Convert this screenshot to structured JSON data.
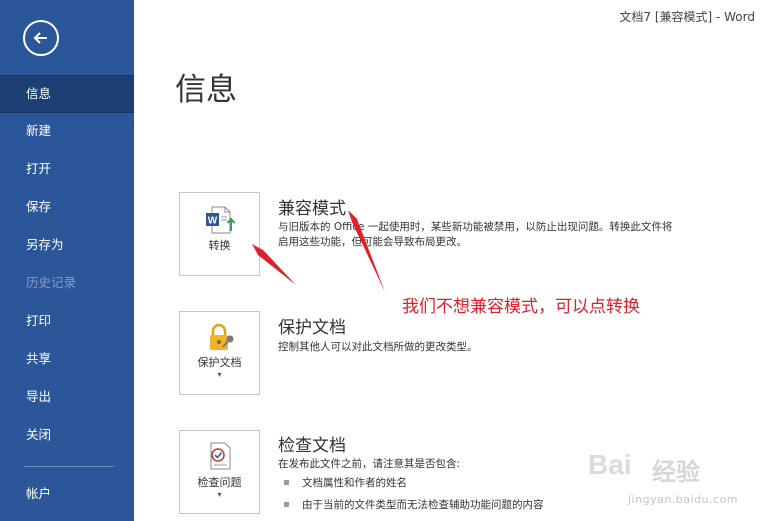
{
  "window": {
    "title": "文档7 [兼容模式]  -  Word"
  },
  "sidebar": {
    "items": [
      {
        "label": "信息"
      },
      {
        "label": "新建"
      },
      {
        "label": "打开"
      },
      {
        "label": "保存"
      },
      {
        "label": "另存为"
      },
      {
        "label": "历史记录"
      },
      {
        "label": "打印"
      },
      {
        "label": "共享"
      },
      {
        "label": "导出"
      },
      {
        "label": "关闭"
      },
      {
        "label": "帐户"
      }
    ]
  },
  "page": {
    "title": "信息"
  },
  "compat": {
    "button_label": "转换",
    "title": "兼容模式",
    "desc_line1": "与旧版本的 Office 一起使用时，某些新功能被禁用，以防止出现问题。转换此文件将",
    "desc_line2": "启用这些功能，但可能会导致布局更改。"
  },
  "protect": {
    "button_label": "保护文档",
    "caret": "▾",
    "title": "保护文档",
    "desc": "控制其他人可以对此文档所做的更改类型。"
  },
  "inspect": {
    "button_label": "检查问题",
    "caret": "▾",
    "title": "检查文档",
    "desc": "在发布此文件之前，请注意其是否包含:",
    "bullets": [
      "文档属性和作者的姓名",
      "由于当前的文件类型而无法检查辅助功能问题的内容"
    ]
  },
  "annotation": {
    "text": "我们不想兼容模式，可以点转换"
  },
  "watermark": {
    "logo": "Bai",
    "brand": "经验",
    "url": "jingyan.baidu.com"
  },
  "colors": {
    "sidebar": "#2b579a",
    "sidebar_active": "#1e3f73",
    "annotation": "#e0202a"
  }
}
